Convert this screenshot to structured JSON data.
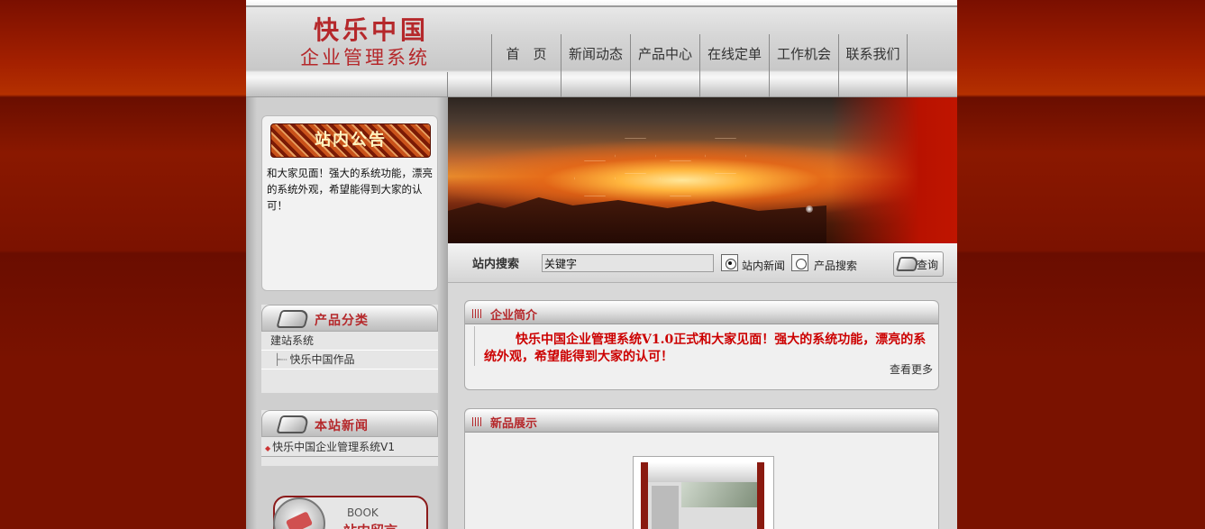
{
  "header": {
    "logo_line1": "快乐中国",
    "logo_line2": "企业管理系统"
  },
  "nav": {
    "items": [
      {
        "label": "首　页"
      },
      {
        "label": "新闻动态"
      },
      {
        "label": "产品中心"
      },
      {
        "label": "在线定单"
      },
      {
        "label": "工作机会"
      },
      {
        "label": "联系我们"
      }
    ]
  },
  "sidebar": {
    "notice_title": "站内公告",
    "notice_text": "和大家见面！强大的系统功能，漂亮的系统外观，希望能得到大家的认可！",
    "category_title": "产品分类",
    "categories": [
      {
        "label": "建站系统"
      },
      {
        "label": "快乐中国作品"
      }
    ],
    "news_title": "本站新闻",
    "news": [
      {
        "label": "快乐中国企业管理系统V1"
      }
    ],
    "book_label": "BOOK",
    "book_sub": "站内留言"
  },
  "search": {
    "label": "站内搜索",
    "input_value": "关键字",
    "radio1": "站内新闻",
    "radio2": "产品搜索",
    "button": "查询"
  },
  "intro": {
    "title": "企业简介",
    "text": "快乐中国企业管理系统V1.0正式和大家见面！强大的系统功能，漂亮的系统外观，希望能得到大家的认可！",
    "more": "查看更多"
  },
  "products": {
    "title": "新品展示"
  },
  "colors": {
    "brand_red": "#b5282b",
    "background_red": "#7a1200",
    "intro_text_red": "#cc0000"
  }
}
